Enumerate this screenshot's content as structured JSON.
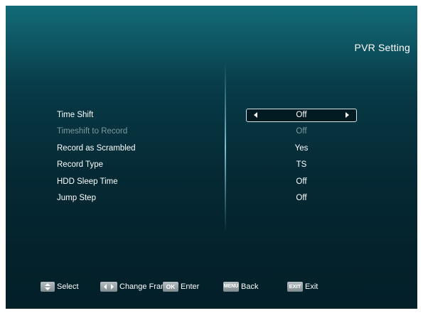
{
  "header": {
    "title": "PVR Setting"
  },
  "settings": [
    {
      "label": "Time Shift",
      "value": "Off",
      "state": "selected"
    },
    {
      "label": "Timeshift to Record",
      "value": "Off",
      "state": "disabled"
    },
    {
      "label": "Record as Scrambled",
      "value": "Yes",
      "state": "normal"
    },
    {
      "label": "Record Type",
      "value": "TS",
      "state": "normal"
    },
    {
      "label": "HDD Sleep Time",
      "value": "Off",
      "state": "normal"
    },
    {
      "label": "Jump Step",
      "value": "Off",
      "state": "normal"
    }
  ],
  "footer": {
    "select_label": "Select",
    "change_label": "Change Fram",
    "ok_key": "OK",
    "enter_label": "Enter",
    "menu_key": "MENU",
    "back_label": "Back",
    "exit_key": "EXIT",
    "exit_label": "Exit"
  },
  "colors": {
    "background_top": "#0d5d6a",
    "background_bottom": "#032029",
    "disabled_text": "#7f99a1",
    "key_button": "#9aa4a8"
  }
}
